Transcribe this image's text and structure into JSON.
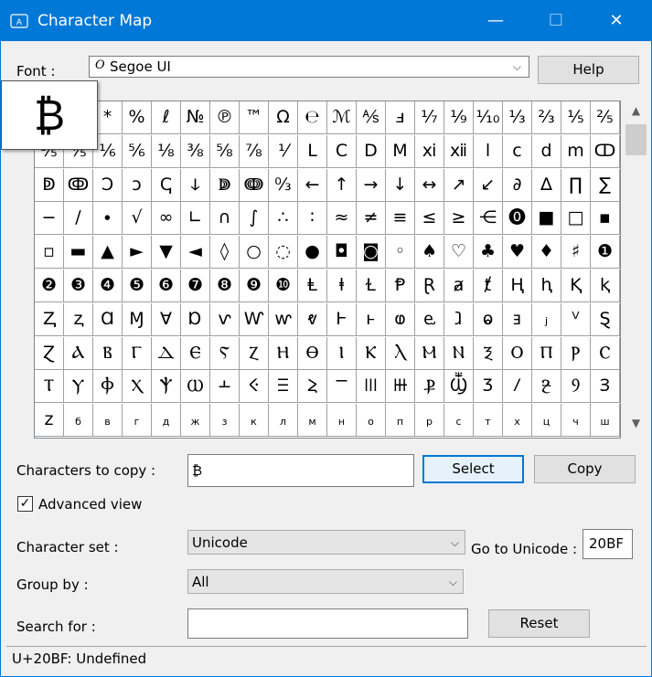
{
  "window": {
    "title": "Character Map",
    "app_icon": "app-icon",
    "min_glyph": "—",
    "max_glyph": "☐",
    "close_glyph": "✕"
  },
  "font_label": "Font :",
  "font": {
    "glyph": "O",
    "value": "Segoe UI",
    "arrow": "⌵"
  },
  "help_label": "Help",
  "zoom_char": "₿",
  "grid": {
    "rows": [
      [
        "₿",
        "",
        "*",
        "%",
        "ℓ",
        "№",
        "℗",
        "™",
        "Ω",
        "℮",
        "ℳ",
        "⅍",
        "ⅎ",
        "⅐",
        "⅑",
        "⅒",
        "⅓",
        "⅔",
        "⅕",
        "⅖"
      ],
      [
        "⅗",
        "⅘",
        "⅙",
        "⅚",
        "⅛",
        "⅜",
        "⅝",
        "⅞",
        "⅟",
        "Ⅼ",
        "Ⅽ",
        "Ⅾ",
        "Ⅿ",
        "ⅺ",
        "ⅻ",
        "ⅼ",
        "ⅽ",
        "ⅾ",
        "ⅿ",
        "ↀ"
      ],
      [
        "ↁ",
        "ↂ",
        "Ↄ",
        "ↄ",
        "ↅ",
        "ↆ",
        "ↇ",
        "ↈ",
        "↉",
        "←",
        "↑",
        "→",
        "↓",
        "↔",
        "↗",
        "↙",
        "∂",
        "∆",
        "∏",
        "∑"
      ],
      [
        "−",
        "∕",
        "∙",
        "√",
        "∞",
        "∟",
        "∩",
        "∫",
        "∴",
        "∶",
        "≈",
        "≠",
        "≡",
        "≤",
        "≥",
        "⋲",
        "⓿",
        "■",
        "□",
        "▪"
      ],
      [
        "▫",
        "▬",
        "▲",
        "►",
        "▼",
        "◄",
        "◊",
        "○",
        "◌",
        "●",
        "◘",
        "◙",
        "◦",
        "♠",
        "♡",
        "♣",
        "♥",
        "♦",
        "♯",
        "❶"
      ],
      [
        "❷",
        "❸",
        "❹",
        "❺",
        "❻",
        "❼",
        "❽",
        "❾",
        "❿",
        "Ⱡ",
        "ⱡ",
        "Ɫ",
        "Ᵽ",
        "Ɽ",
        "ⱥ",
        "ⱦ",
        "Ⱨ",
        "ⱨ",
        "Ⱪ",
        "ⱪ"
      ],
      [
        "Ⱬ",
        "ⱬ",
        "Ɑ",
        "Ɱ",
        "Ɐ",
        "Ɒ",
        "ⱱ",
        "Ⱳ",
        "ⱳ",
        "ⱴ",
        "Ⱶ",
        "ⱶ",
        "ⱷ",
        "ⱸ",
        "ⱹ",
        "ⱺ",
        "ⱻ",
        "ⱼ",
        "ⱽ",
        "Ȿ"
      ],
      [
        "Ɀ",
        "Ⲁ",
        "Ⲃ",
        "Ⲅ",
        "Ⲇ",
        "Ⲉ",
        "Ⲋ",
        "Ⲍ",
        "Ⲏ",
        "Ⲑ",
        "Ⲓ",
        "Ⲕ",
        "Ⲗ",
        "Ⲙ",
        "Ⲛ",
        "Ⲝ",
        "Ⲟ",
        "Ⲡ",
        "Ⲣ",
        "Ⲥ"
      ],
      [
        "Ⲧ",
        "Ⲩ",
        "Ⲫ",
        "Ⲭ",
        "Ⲯ",
        "Ⲱ",
        "Ⲳ",
        "Ⲵ",
        "Ⲷ",
        "Ⲹ",
        "Ⲻ",
        "Ⲽ",
        "Ⲿ",
        "Ⳁ",
        "Ⳃ",
        "Ⳅ",
        "Ⳇ",
        "Ⳉ",
        "Ⳋ",
        "Ⳍ"
      ],
      [
        "z",
        "б",
        "в",
        "г",
        "д",
        "ж",
        "з",
        "к",
        "л",
        "м",
        "н",
        "о",
        "п",
        "р",
        "с",
        "т",
        "х",
        "ц",
        "ч",
        "ш"
      ]
    ],
    "small_row_index": 9
  },
  "characters_to_copy": {
    "label": "Characters to copy :",
    "value": "₿"
  },
  "select_label": "Select",
  "copy_label": "Copy",
  "advanced_view": {
    "label": "Advanced view",
    "checked_glyph": "✓"
  },
  "character_set": {
    "label": "Character set :",
    "value": "Unicode",
    "arrow": "⌵"
  },
  "go_to_unicode": {
    "label": "Go to Unicode :",
    "value": "20BF"
  },
  "group_by": {
    "label": "Group by :",
    "value": "All",
    "arrow": "⌵"
  },
  "search_for": {
    "label": "Search for :",
    "value": ""
  },
  "reset_label": "Reset",
  "status": "U+20BF: Undefined",
  "scroll": {
    "up": "▲",
    "down": "▼"
  },
  "colors": {
    "titlebar": "#0078d7",
    "background": "#f0f0f0"
  }
}
